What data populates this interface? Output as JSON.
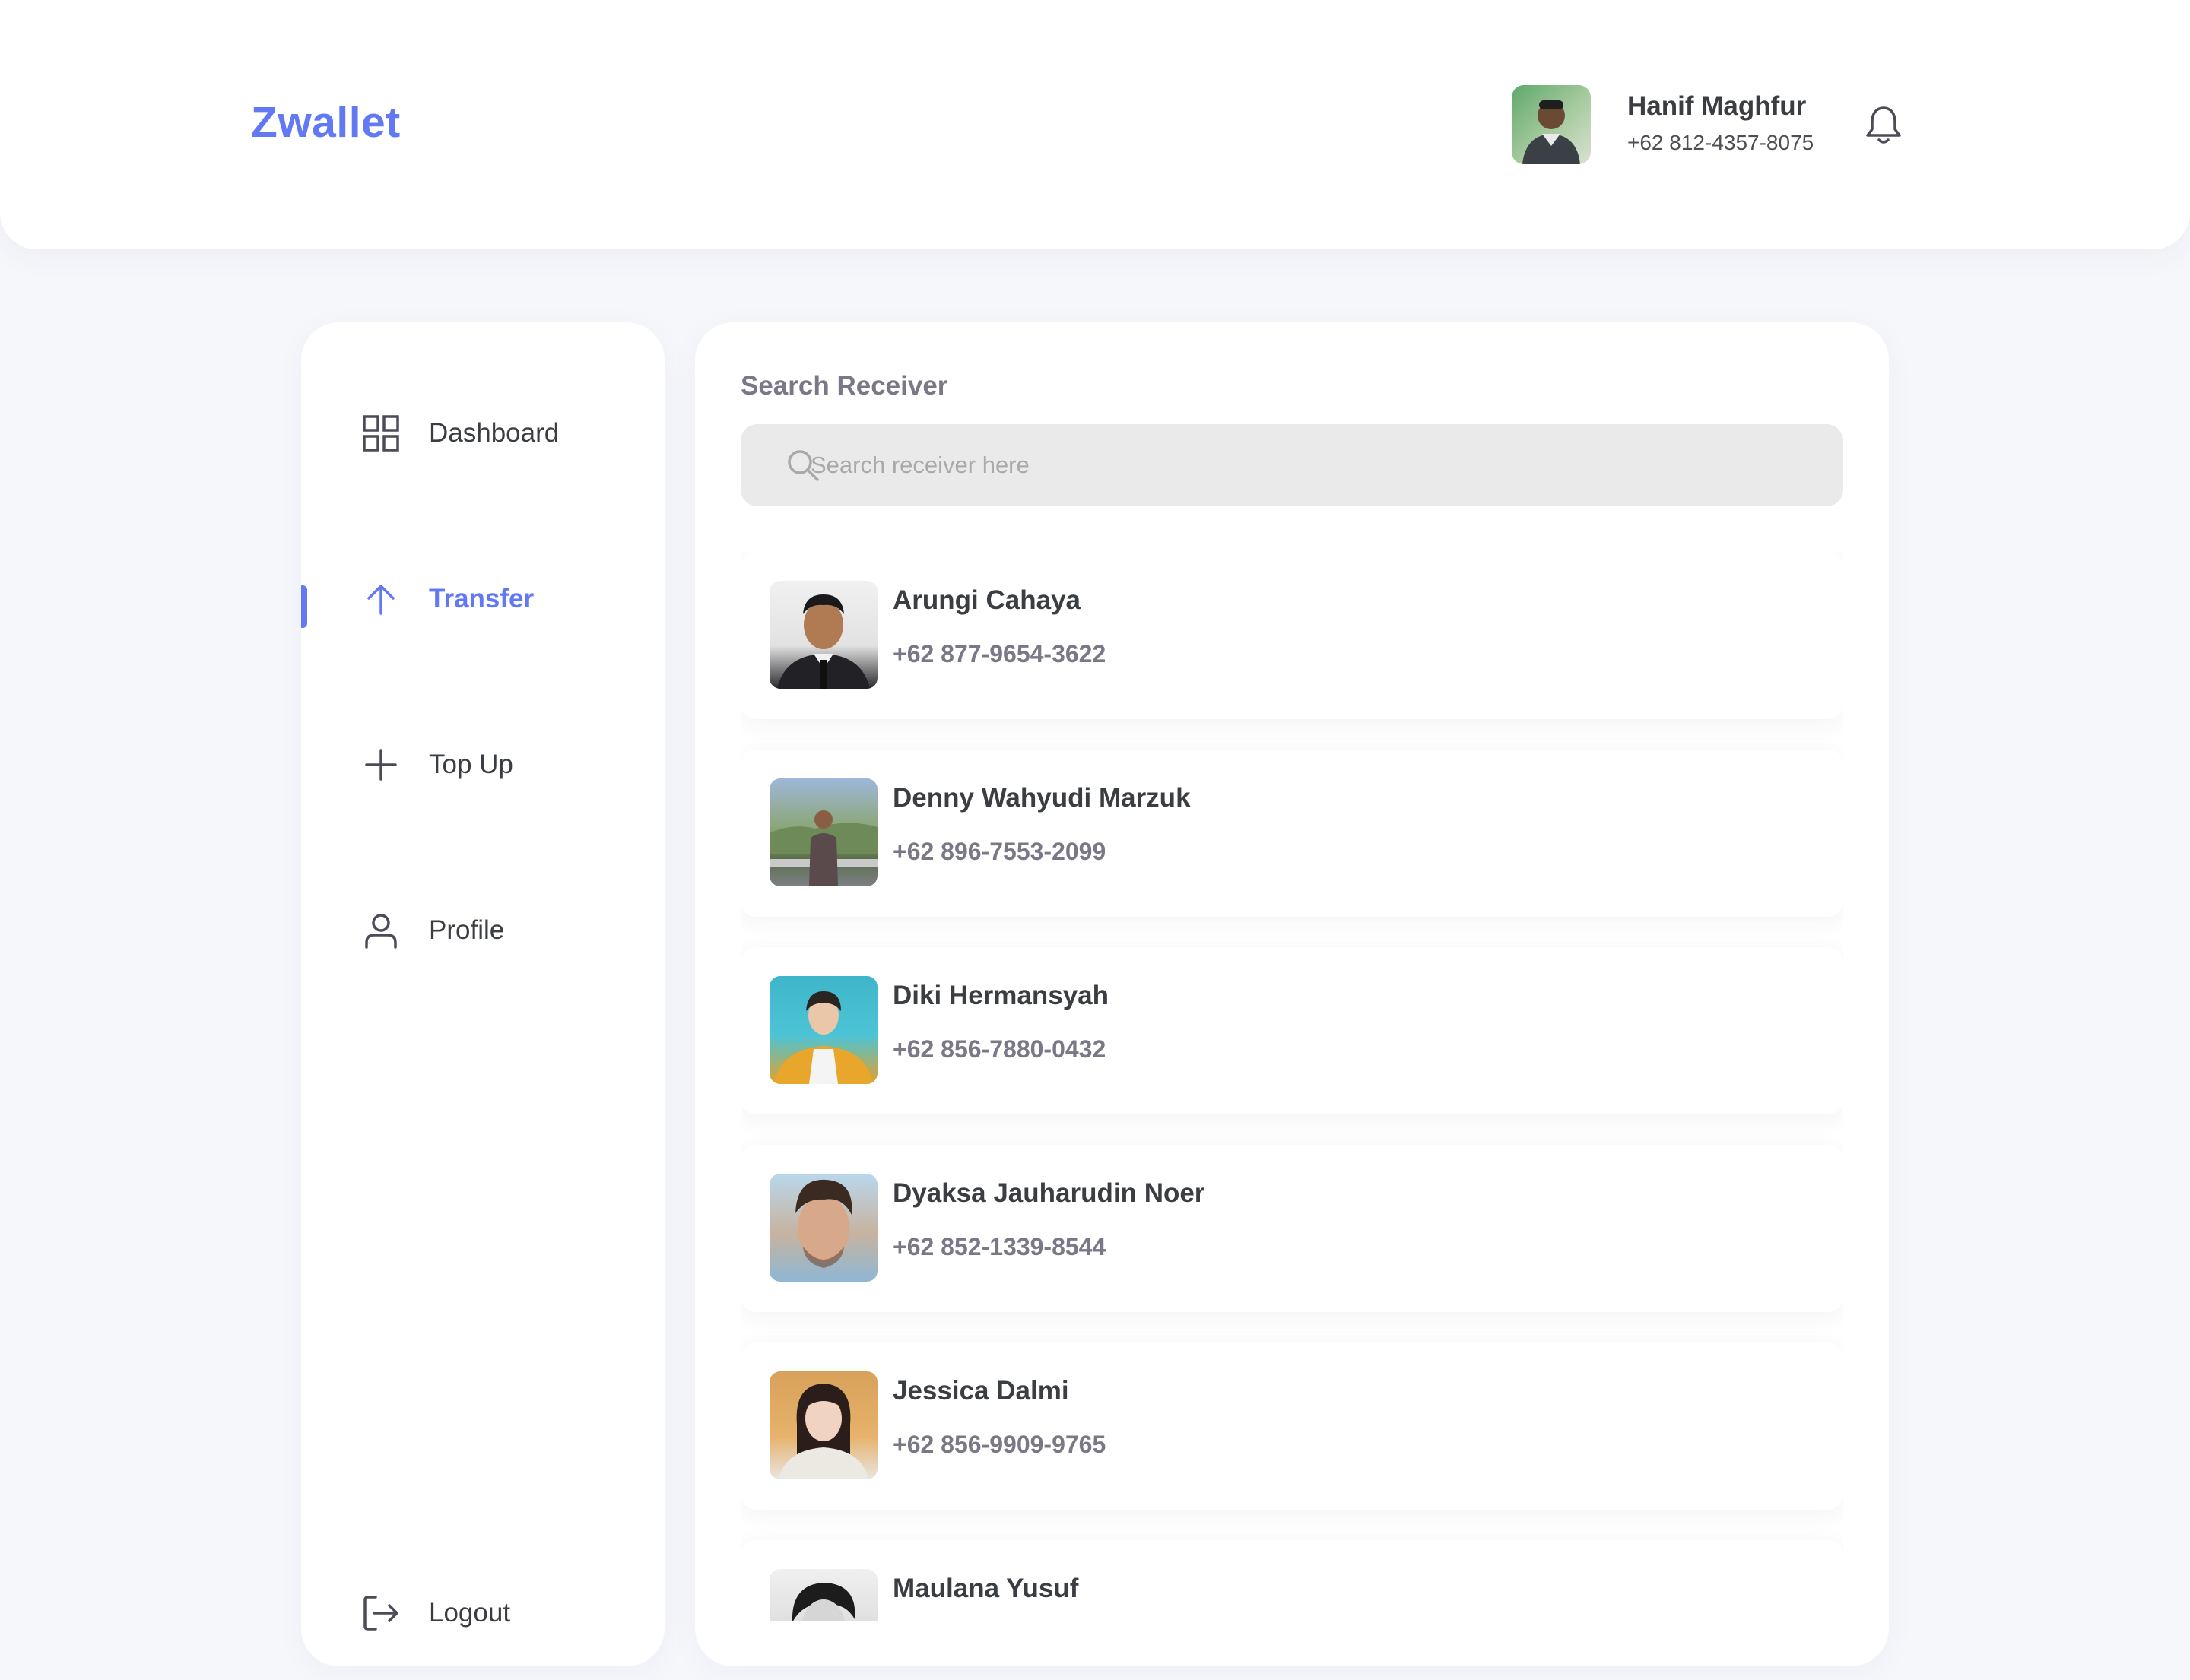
{
  "header": {
    "brand": "Zwallet",
    "user": {
      "name": "Hanif Maghfur",
      "phone": "+62 812-4357-8075"
    },
    "notification_icon": "bell-icon"
  },
  "sidebar": {
    "items": [
      {
        "label": "Dashboard",
        "icon": "grid-icon",
        "active": false
      },
      {
        "label": "Transfer",
        "icon": "arrow-up-icon",
        "active": true
      },
      {
        "label": "Top Up",
        "icon": "plus-icon",
        "active": false
      },
      {
        "label": "Profile",
        "icon": "user-icon",
        "active": false
      }
    ],
    "logout_label": "Logout",
    "logout_icon": "logout-icon",
    "accent": "#6379F4"
  },
  "main": {
    "title": "Search Receiver",
    "search": {
      "placeholder": "Search receiver here",
      "value": ""
    },
    "receivers": [
      {
        "name": "Arungi Cahaya",
        "phone": "+62 877-9654-3622"
      },
      {
        "name": "Denny Wahyudi Marzuk",
        "phone": "+62 896-7553-2099"
      },
      {
        "name": "Diki Hermansyah",
        "phone": "+62 856-7880-0432"
      },
      {
        "name": "Dyaksa Jauharudin Noer",
        "phone": "+62 852-1339-8544"
      },
      {
        "name": "Jessica Dalmi",
        "phone": "+62 856-9909-9765"
      },
      {
        "name": "Maulana Yusuf",
        "phone": ""
      }
    ]
  }
}
